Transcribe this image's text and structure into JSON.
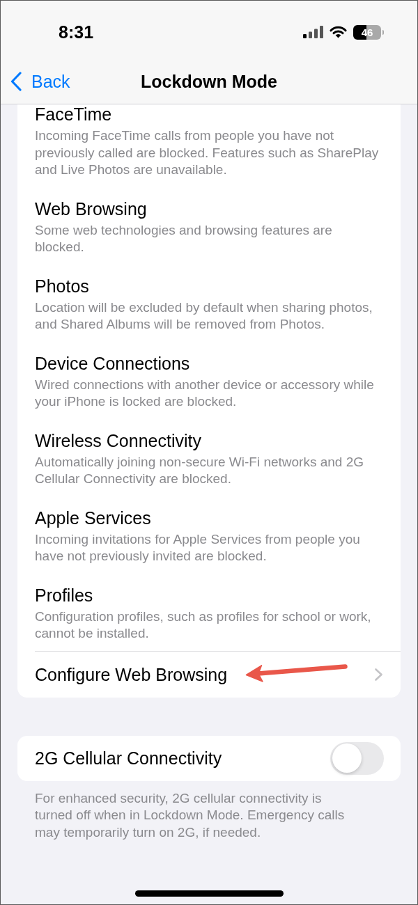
{
  "status_bar": {
    "time": "8:31",
    "battery": "46"
  },
  "navigation_bar": {
    "back_button": "Back",
    "title": "Lockdown Mode"
  },
  "restrictions": [
    {
      "title": "FaceTime",
      "description": "Incoming FaceTime calls from people you have not previously called are blocked. Features such as SharePlay and Live Photos are unavailable."
    },
    {
      "title": "Web Browsing",
      "description": "Some web technologies and browsing features are blocked."
    },
    {
      "title": "Photos",
      "description": "Location will be excluded by default when sharing photos, and Shared Albums will be removed from Photos."
    },
    {
      "title": "Device Connections",
      "description": "Wired connections with another device or accessory while your iPhone is locked are blocked."
    },
    {
      "title": "Wireless Connectivity",
      "description": "Automatically joining non-secure Wi-Fi networks and 2G Cellular Connectivity are blocked."
    },
    {
      "title": "Apple Services",
      "description": "Incoming invitations for Apple Services from people you have not previously invited are blocked."
    },
    {
      "title": "Profiles",
      "description": "Configuration profiles, such as profiles for school or work, cannot be installed."
    }
  ],
  "configure_row": {
    "label": "Configure Web Browsing",
    "annotation": {
      "kind": "arrow"
    }
  },
  "cellular_setting": {
    "label": "2G Cellular Connectivity",
    "on": false
  },
  "footer_note": "For enhanced security, 2G cellular connectivity is turned off when in Lockdown Mode. Emergency calls may temporarily turn on 2G, if needed."
}
